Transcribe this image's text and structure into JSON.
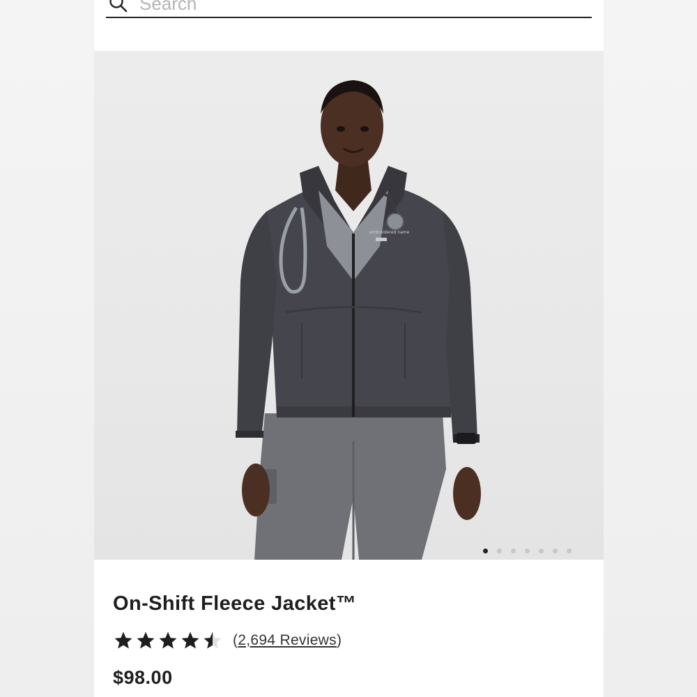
{
  "search": {
    "placeholder": "Search",
    "icon": "search-icon"
  },
  "gallery": {
    "image_alt": "Model wearing charcoal fleece jacket with stethoscope and grey scrub pants",
    "slide_count": 7,
    "active_slide": 1
  },
  "product": {
    "title": "On-Shift Fleece Jacket™",
    "rating": 4.5,
    "rating_max": 5,
    "reviews_open": "(",
    "reviews_label": "2,694 Reviews",
    "reviews_close": ")",
    "price": "$98.00"
  },
  "colors": {
    "text": "#1e1e1e",
    "jacket": "#45454d",
    "star": "#1e1e1e"
  }
}
